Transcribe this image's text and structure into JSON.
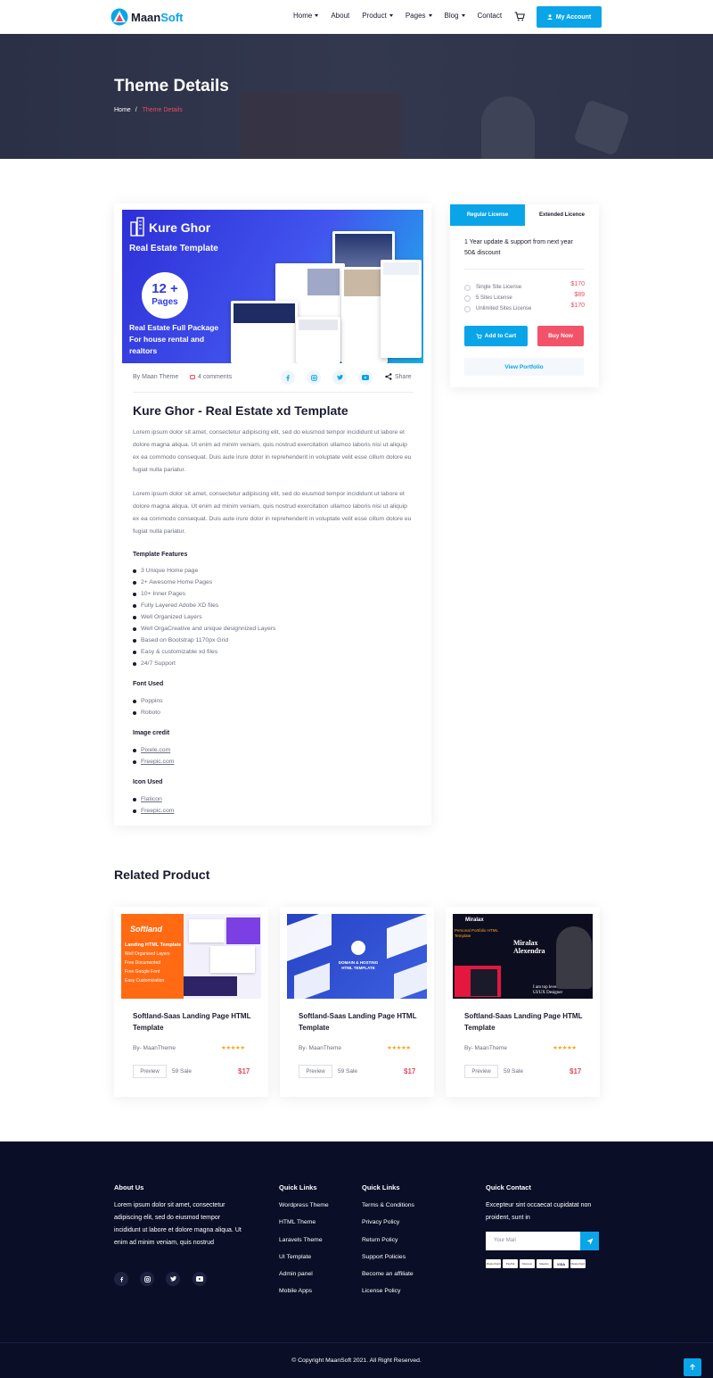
{
  "header": {
    "brand_part1": "Maan",
    "brand_part2": "Soft",
    "nav": [
      {
        "label": "Home",
        "dropdown": true
      },
      {
        "label": "About",
        "dropdown": false
      },
      {
        "label": "Product",
        "dropdown": true
      },
      {
        "label": "Pages",
        "dropdown": true
      },
      {
        "label": "Blog",
        "dropdown": true
      },
      {
        "label": "Contact",
        "dropdown": false
      }
    ],
    "account_label": "My Account"
  },
  "hero": {
    "title": "Theme Details",
    "breadcrumb_home": "Home",
    "breadcrumb_sep": "/",
    "breadcrumb_current": "Theme Details"
  },
  "product": {
    "banner": {
      "title": "Kure Ghor",
      "subtitle": "Real Estate Template",
      "pages_count": "12 +",
      "pages_label": "Pages",
      "package_text": "Real Estate Full Package For house rental and realtors"
    },
    "author": "By Maan Theme",
    "comments": "4 comments",
    "share_label": "Share",
    "social_icons": [
      "facebook-icon",
      "instagram-icon",
      "twitter-icon",
      "youtube-icon"
    ],
    "title": "Kure Ghor - Real Estate xd Template",
    "paragraph1": "Lorem ipsum dolor sit amet, consectetur adipiscing elit, sed do eiusmod tempor incididunt ut labore et dolore magna aliqua. Ut enim ad minim veniam, quis nostrud exercitation ullamco laboris nisi ut aliquip ex ea commodo consequat. Duis aute irure dolor in reprehenderit in voluptate velit esse cillum dolore eu fugiat nulla pariatur.",
    "paragraph2": "Lorem ipsum dolor sit amet, consectetur adipiscing elit, sed do eiusmod tempor incididunt ut labore et dolore magna aliqua. Ut enim ad minim veniam, quis nostrud exercitation ullamco laboris nisi ut aliquip ex ea commodo consequat. Duis aute irure dolor in reprehenderit in voluptate velit esse cillum dolore eu fugiat nulla pariatur.",
    "features_heading": "Template Features",
    "features": [
      "3 Unique Home page",
      "2+ Awesome Home Pages",
      "10+ Inner Pages",
      "Fully Layered Adobe XD files",
      "Well Organized Layers",
      "Well OrgaCreative and unique designnized Layers",
      "Based on Bootstrap 1170px Grid",
      "Easy & customizable xd files",
      "24/7 Support"
    ],
    "font_heading": "Font Used",
    "fonts": [
      "Poppins",
      "Roboto"
    ],
    "image_heading": "Image credit",
    "image_credits": [
      "Pixele.com",
      "Freepic.com"
    ],
    "icon_heading": "Icon Used",
    "icons_used": [
      "Flaticon",
      "Freepic.com"
    ]
  },
  "license": {
    "tab_regular": "Regular License",
    "tab_extended": "Extended Licence",
    "description": "1 Year update & support from next year 50& discount",
    "options": [
      {
        "label": "Single Site License",
        "price": "$170"
      },
      {
        "label": "5 Sites License",
        "price": "$89"
      },
      {
        "label": "Unlimited Sites License",
        "price": "$170"
      }
    ],
    "add_to_cart": "Add to Cart",
    "buy_now": "Buy Now",
    "view_portfolio": "View Portfolio"
  },
  "related": {
    "heading": "Related Product",
    "items": [
      {
        "name": "Softland-Saas Landing Page HTML Template",
        "by": "By- MaanTheme",
        "stars": "★★★★★",
        "preview": "Preview",
        "sales": "59 Sale",
        "price": "$17",
        "img_title": "Softland",
        "img_lines": [
          "Landing HTML Template",
          "Well Organised Layers",
          "Free Documented",
          "Free Google Font",
          "Easy Customization"
        ]
      },
      {
        "name": "Softland-Saas Landing Page HTML Template",
        "by": "By- MaanTheme",
        "stars": "★★★★★",
        "preview": "Preview",
        "sales": "59 Sale",
        "price": "$17",
        "img_title": "DOMAIN & HOSTING HTML TEMPLATE"
      },
      {
        "name": "Softland-Saas Landing Page HTML Template",
        "by": "By- MaanTheme",
        "stars": "★★★★★",
        "preview": "Preview",
        "sales": "59 Sale",
        "price": "$17",
        "img_title": "Miralax",
        "img_sub": "Personal Portfolio HTML Template",
        "img_name": "Miralax Alexendra",
        "img_role": "I am top level UI/UX Designer"
      }
    ]
  },
  "footer": {
    "about_heading": "About Us",
    "about_text": "Lorem ipsum dolor sit amet, consectetur adipiscing elit, sed do eiusmod tempor incididunt ut labore et dolore magna aliqua. Ut enim ad minim veniam, quis nostrud",
    "quick_links_heading_1": "Quick Links",
    "quick_links_1": [
      "Wordpress Theme",
      "HTML Theme",
      "Laravels Theme",
      "UI Template",
      "Admin panel",
      "Mobile Apps"
    ],
    "quick_links_heading_2": "Quick Links",
    "quick_links_2": [
      "Terms & Conditions",
      "Privacy Policy",
      "Return Policy",
      "Support Policies",
      "Become an affiliate",
      "License Policy"
    ],
    "contact_heading": "Quick Contact",
    "contact_text": "Excepteur sint occaecat cupidatat non proident, sunt in",
    "mail_placeholder": "Your Mail",
    "payment_methods": [
      "MasterCard",
      "PayPal",
      "Discover",
      "Maestro",
      "VISA",
      "MasterCard"
    ],
    "copyright": "© Copyright MaanSoft 2021. All Right Reserved."
  },
  "colors": {
    "accent": "#0aa5e8",
    "price_red": "#e84a5f",
    "footer_bg": "#0a0e27"
  }
}
